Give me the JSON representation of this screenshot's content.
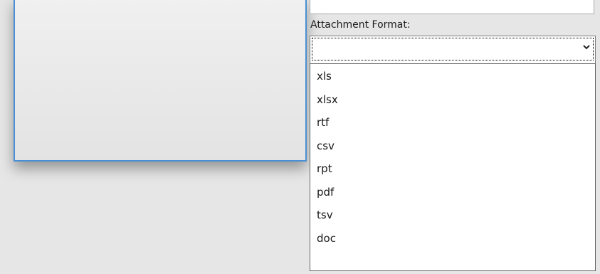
{
  "form": {
    "attachment_format_label": "Attachment Format:",
    "attachment_format_value": ""
  },
  "dropdown": {
    "options": [
      "xls",
      "xlsx",
      "rtf",
      "csv",
      "rpt",
      "pdf",
      "tsv",
      "doc"
    ]
  },
  "icons": {
    "combo_arrow": "chevron-down-icon"
  },
  "colors": {
    "panel_border": "#4a8fd4",
    "background": "#e6e6e6"
  }
}
